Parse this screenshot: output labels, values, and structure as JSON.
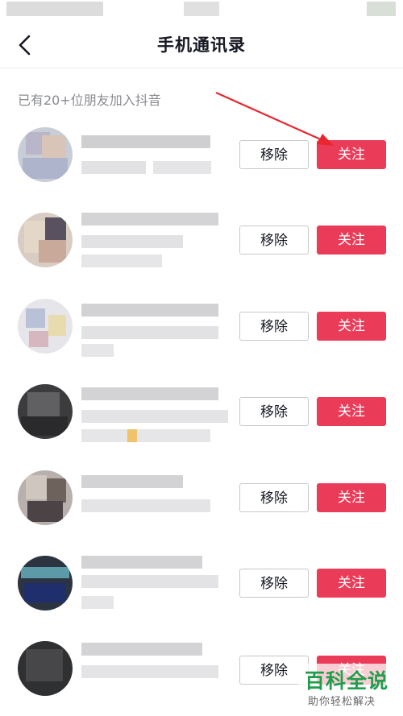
{
  "header": {
    "title": "手机通讯录",
    "back_icon": "chevron-left-icon"
  },
  "subtitle": "已有20+位朋友加入抖音",
  "buttons": {
    "remove": "移除",
    "follow": "关注"
  },
  "colors": {
    "follow": "#ea3c58",
    "annotation_arrow": "#e8262e",
    "watermark": "#1f9e4b"
  },
  "contacts_count": 7,
  "watermark": {
    "title": "百科全说",
    "subtitle": "助你轻松解决"
  }
}
